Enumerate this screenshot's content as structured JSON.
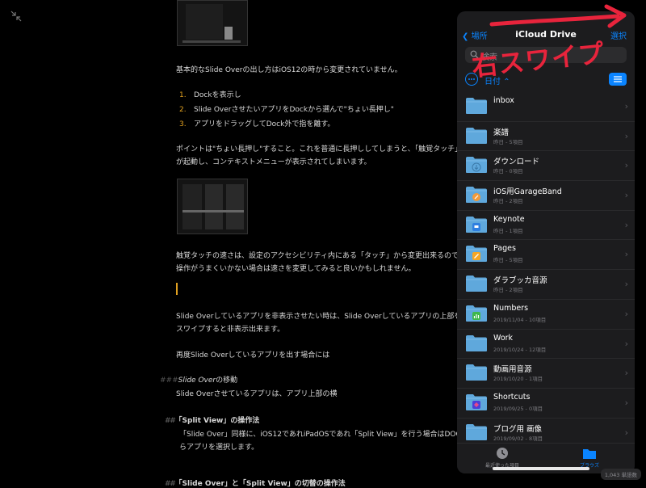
{
  "document": {
    "para1": "基本的なSlide Overの出し方はiOS12の時から変更されていません。",
    "list": [
      {
        "num": "1.",
        "text": "Dockを表示し"
      },
      {
        "num": "2.",
        "text": "Slide OverさせたいアプリをDockから選んで\"ちょい長押し\""
      },
      {
        "num": "3.",
        "text": "アプリをドラッグしてDock外で指を離す。"
      }
    ],
    "para2_line1": "ポイントは\"ちょい長押し\"すること。これを普通に長押ししてしまうと、「触覚タッチ」",
    "para2_line2": "が起動し、コンテキストメニューが表示されてしまいます。",
    "para3_line1": "触覚タッチの速さは、設定のアクセシビリティ内にある「タッチ」から変更出来るので",
    "para3_line2": "操作がうまくいかない場合は速さを変更してみると良いかもしれません。",
    "para4_line1": "Slide Overしているアプリを非表示させたい時は、Slide Overしているアプリの上部を",
    "para4_line2": "スワイプすると非表示出来ます。",
    "para5": "再度Slide Overしているアプリを出す場合には",
    "h3_hash": "###",
    "h3_italic": "Slide Over",
    "h3_rest": "の移動",
    "para6": "Slide Overさせているアプリは、アプリ上部の横",
    "h2a_hash": "##",
    "h2a_text": "「Split View」の操作法",
    "para7_line1": "「Slide Over」同様に、iOS12であれiPadOSであれ「Split View」を行う場合はDOC",
    "para7_line2": "らアプリを選択します。",
    "h2b_hash": "##",
    "h2b_text": "「Slide Over」と「Split View」の切替の操作法"
  },
  "panel": {
    "back_label": "場所",
    "title": "iCloud Drive",
    "select_label": "選択",
    "search_placeholder": "検索",
    "sort_label": "日付",
    "files": [
      {
        "name": "inbox",
        "meta": "",
        "icon": "folder"
      },
      {
        "name": "楽譜",
        "meta": "昨日 - 5項目",
        "icon": "folder"
      },
      {
        "name": "ダウンロード",
        "meta": "昨日 - 0項目",
        "icon": "download-folder"
      },
      {
        "name": "iOS用GarageBand",
        "meta": "昨日 - 2項目",
        "icon": "garageband-folder"
      },
      {
        "name": "Keynote",
        "meta": "昨日 - 1項目",
        "icon": "keynote-folder"
      },
      {
        "name": "Pages",
        "meta": "昨日 - 5項目",
        "icon": "pages-folder"
      },
      {
        "name": "ダラブッカ音源",
        "meta": "昨日 - 2項目",
        "icon": "folder"
      },
      {
        "name": "Numbers",
        "meta": "2019/11/04 - 10項目",
        "icon": "numbers-folder"
      },
      {
        "name": "Work",
        "meta": "2019/10/24 - 12項目",
        "icon": "folder"
      },
      {
        "name": "動画用音源",
        "meta": "2019/10/20 - 1項目",
        "icon": "folder"
      },
      {
        "name": "Shortcuts",
        "meta": "2019/09/25 - 0項目",
        "icon": "shortcuts-folder"
      },
      {
        "name": "ブログ用 画像",
        "meta": "2019/09/02 - 8項目",
        "icon": "folder"
      }
    ],
    "tab_recent": "最近使った項目",
    "tab_browse": "ブラウズ"
  },
  "status": {
    "word_count": "1,043 単語数"
  },
  "annotation": {
    "text": "右スワイプ"
  },
  "colors": {
    "accent": "#0a84ff",
    "folder": "#5fa8dc",
    "annotation": "#e8243c",
    "list_number": "#e0a020"
  }
}
